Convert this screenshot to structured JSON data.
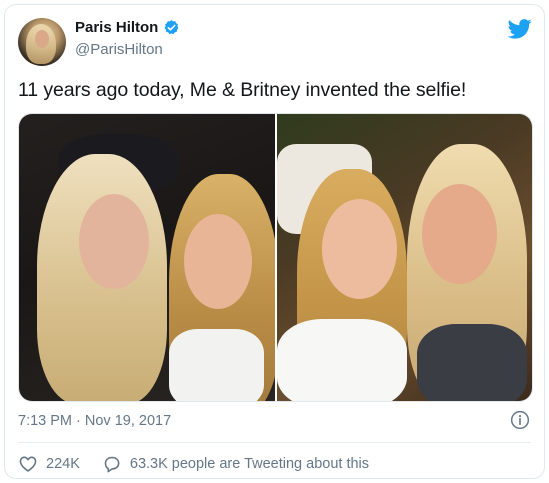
{
  "author": {
    "display_name": "Paris Hilton",
    "handle": "@ParisHilton",
    "verified": true
  },
  "tweet": {
    "text": "11 years ago today, Me & Britney invented the selfie!",
    "timestamp": "7:13 PM · Nov 19, 2017"
  },
  "engagement": {
    "likes": "224K",
    "replies_text": "63.3K people are Tweeting about this"
  },
  "colors": {
    "brand": "#1da1f2",
    "text_primary": "#14171a",
    "text_secondary": "#657786",
    "border": "#e1e8ed"
  },
  "icons": [
    "verified-badge-icon",
    "twitter-bird-icon",
    "info-icon",
    "heart-icon",
    "comment-icon"
  ],
  "media": {
    "photo_count": 2
  }
}
